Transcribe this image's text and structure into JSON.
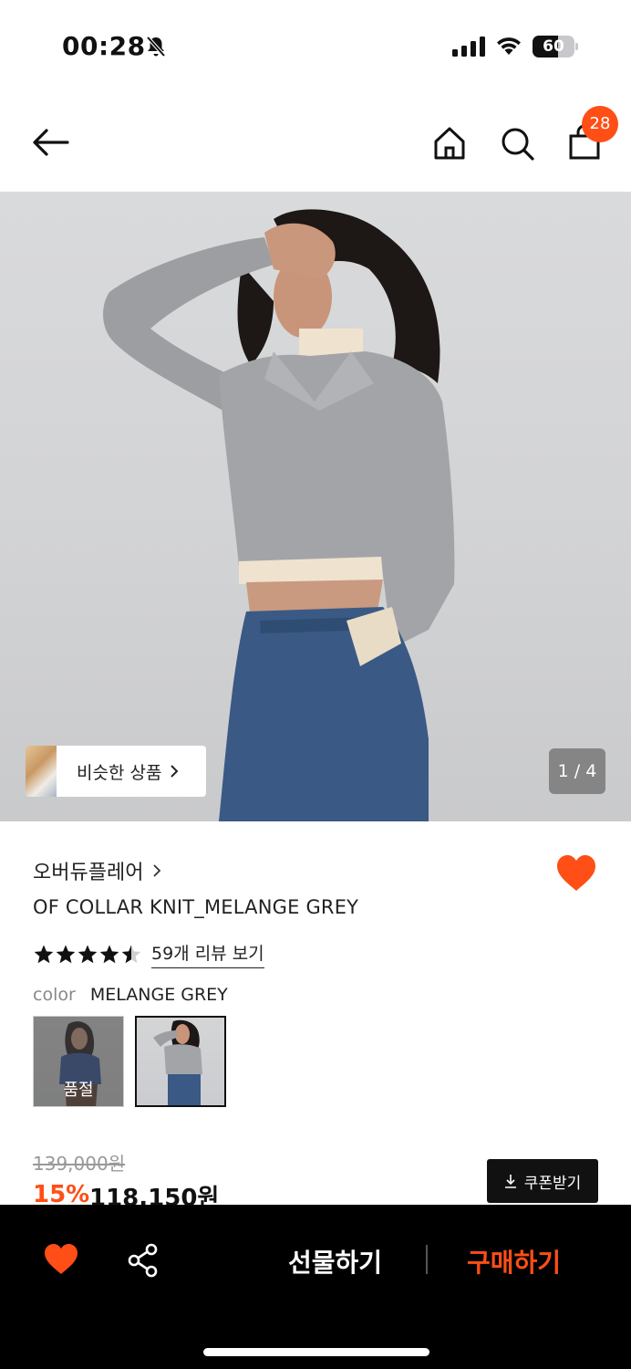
{
  "status_bar": {
    "time": "00:28",
    "battery": "60",
    "battery_level": 0.6
  },
  "header": {
    "cart_count": "28"
  },
  "gallery": {
    "similar_label": "비슷한 상품",
    "pager": "1 / 4"
  },
  "product": {
    "brand": "오버듀플레어",
    "name": "OF COLLAR KNIT_MELANGE GREY",
    "rating": 4.5,
    "review_link": "59개 리뷰 보기",
    "color_key": "color",
    "color_value": "MELANGE GREY",
    "swatches": [
      {
        "status": "품절"
      },
      {
        "status": ""
      }
    ],
    "original_price": "139,000원",
    "discount": "15%",
    "sale_price": "118,150원",
    "coupon_label": "쿠폰받기"
  },
  "bottom_bar": {
    "gift_label": "선물하기",
    "buy_label": "구매하기"
  },
  "colors": {
    "accent": "#ff4e16",
    "dark": "#000000"
  }
}
